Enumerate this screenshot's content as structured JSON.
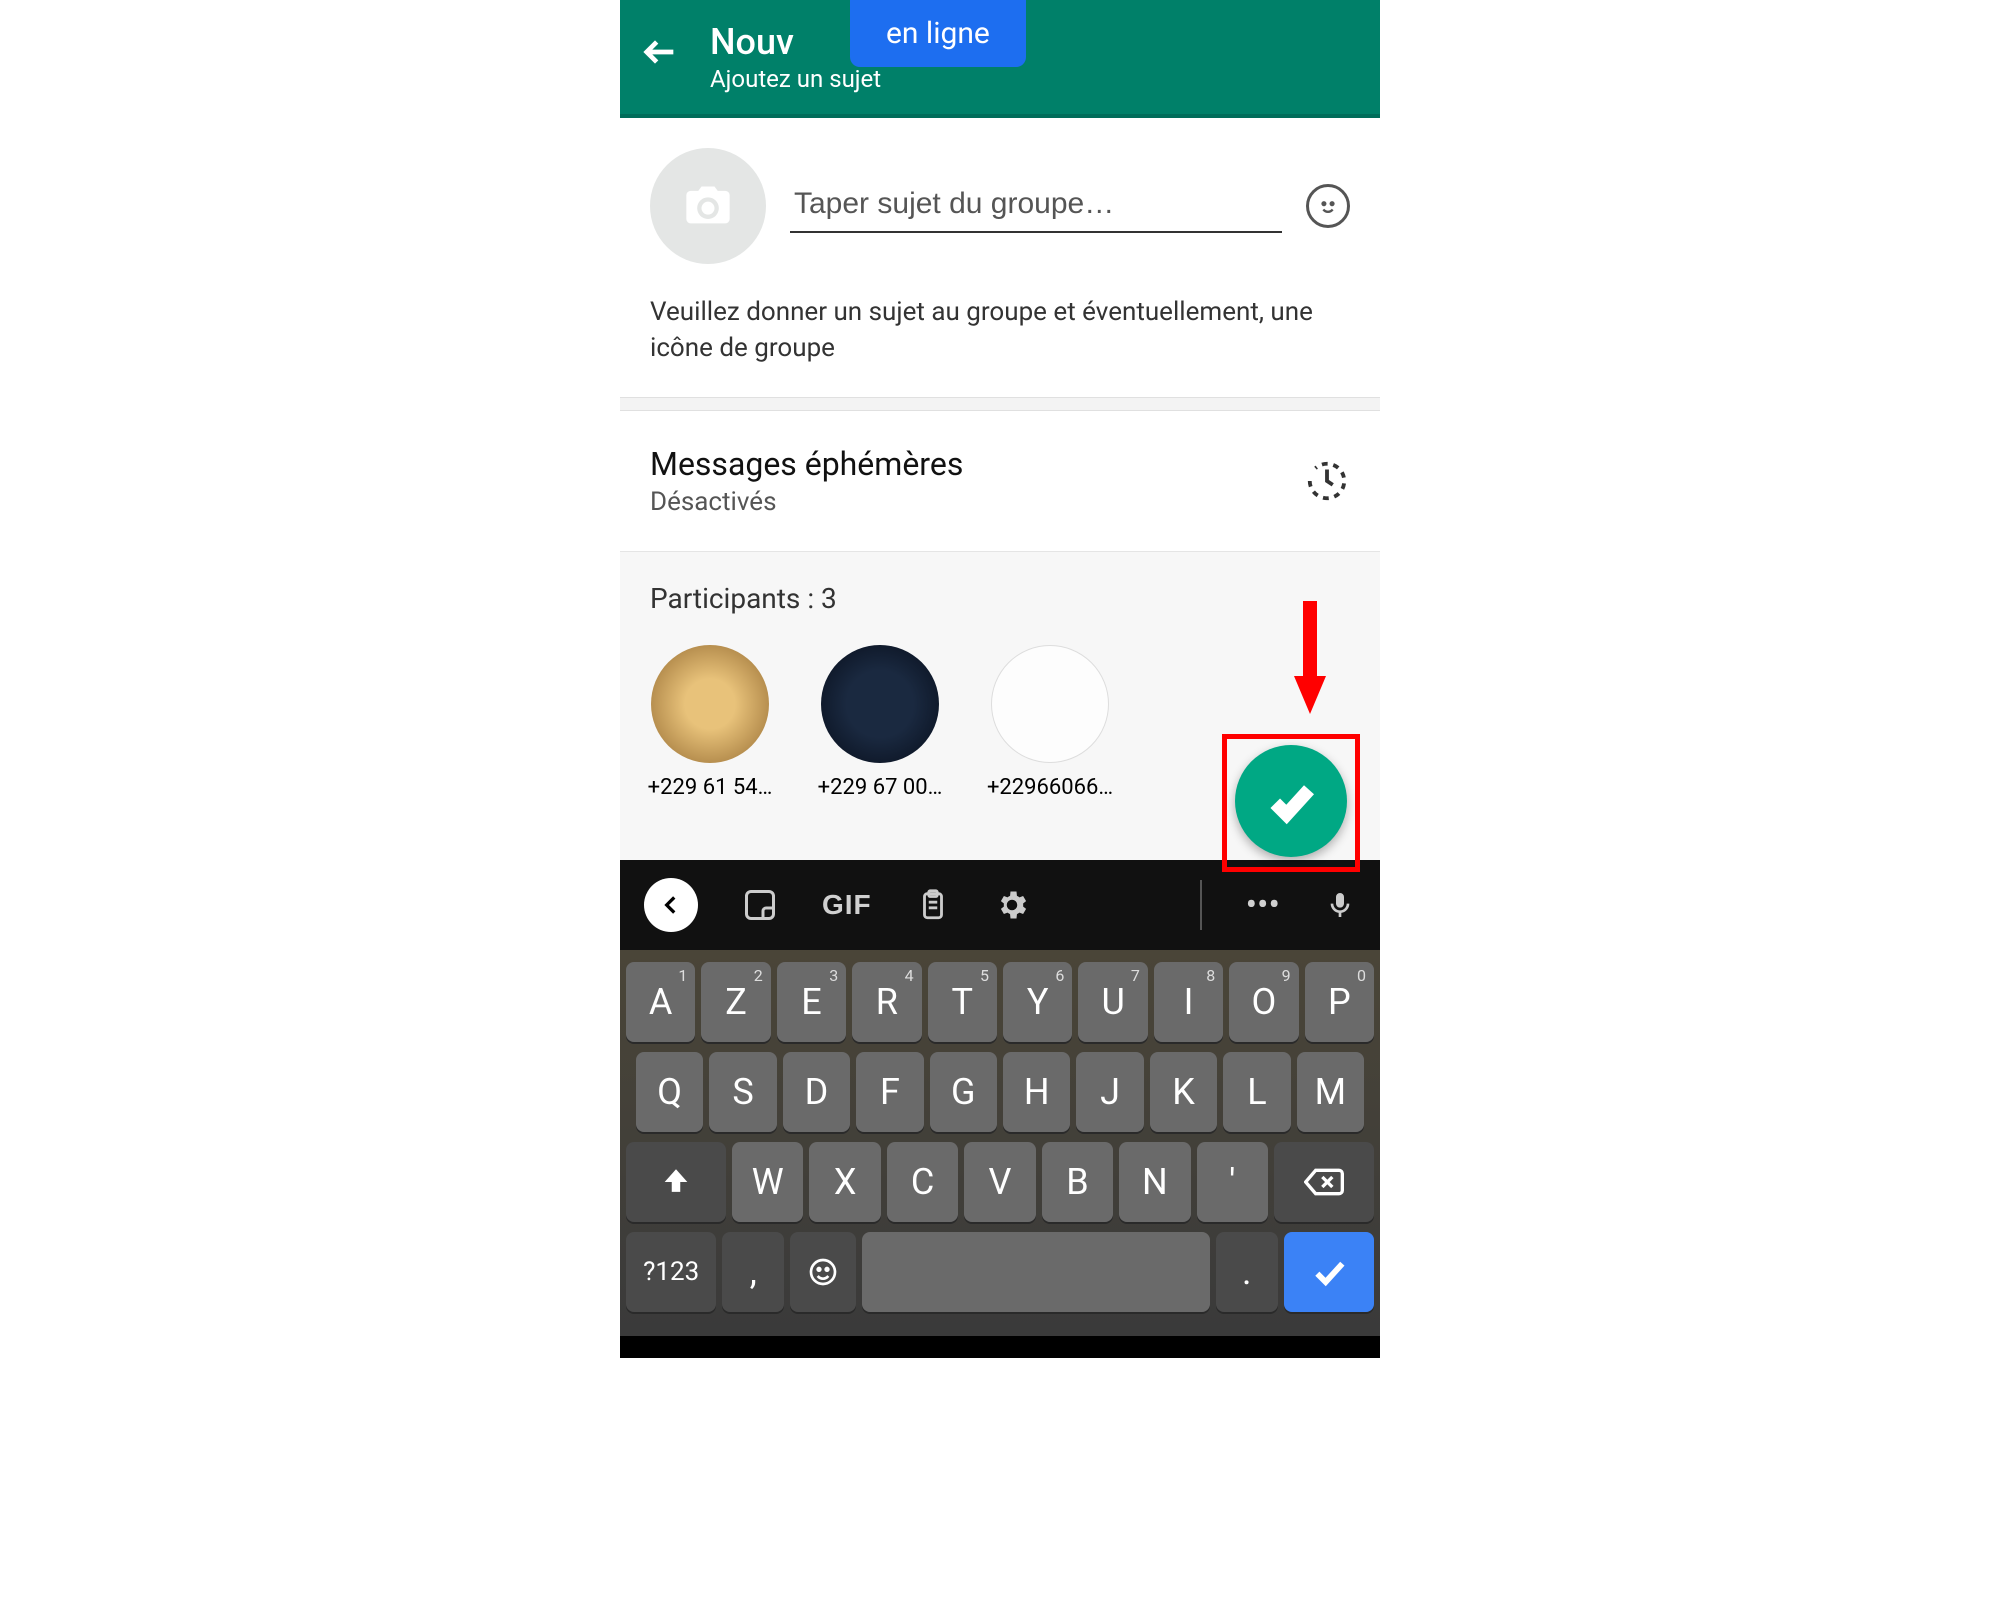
{
  "header": {
    "title_visible": "Nouv",
    "subtitle": "Ajoutez un sujet",
    "online_label": "en ligne"
  },
  "subject": {
    "placeholder": "Taper sujet du groupe…"
  },
  "instruction": "Veuillez donner un sujet au groupe et éventuellement, une icône de groupe",
  "ephemeral": {
    "title": "Messages éphémères",
    "status": "Désactivés"
  },
  "participants": {
    "label": "Participants : 3",
    "items": [
      {
        "phone": "+229 61 54…"
      },
      {
        "phone": "+229 67 00…"
      },
      {
        "phone": "+22966066…"
      }
    ]
  },
  "keyboard": {
    "gif_label": "GIF",
    "row1": [
      "A",
      "Z",
      "E",
      "R",
      "T",
      "Y",
      "U",
      "I",
      "O",
      "P"
    ],
    "row1_sup": [
      "1",
      "2",
      "3",
      "4",
      "5",
      "6",
      "7",
      "8",
      "9",
      "0"
    ],
    "row2": [
      "Q",
      "S",
      "D",
      "F",
      "G",
      "H",
      "J",
      "K",
      "L",
      "M"
    ],
    "row3": [
      "W",
      "X",
      "C",
      "V",
      "B",
      "N",
      "'"
    ],
    "num_label": "?123",
    "comma": ",",
    "dot": "."
  }
}
